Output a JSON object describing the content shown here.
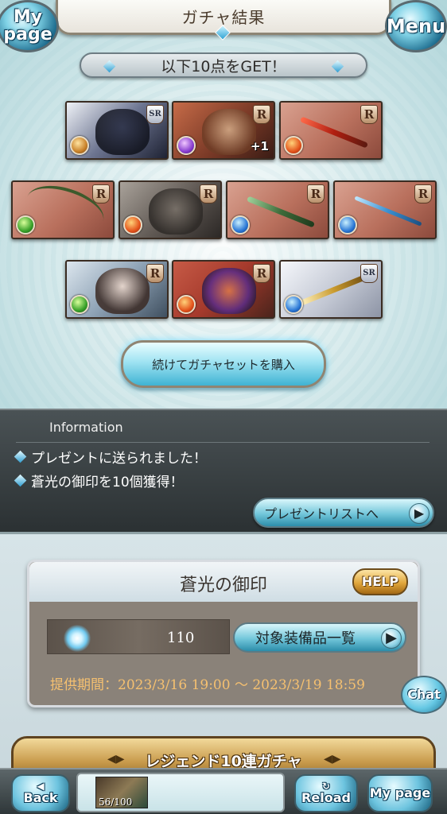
{
  "header": {
    "title": "ガチャ結果",
    "mypage_label": "My page",
    "menu_label": "Menu"
  },
  "banner": {
    "text": "以下10点をGET！"
  },
  "results": [
    {
      "rarity": "SR",
      "kind": "character",
      "element": "earth"
    },
    {
      "rarity": "R",
      "kind": "summon",
      "element": "dark",
      "badge": "+1"
    },
    {
      "rarity": "R",
      "kind": "weapon",
      "element": "fire"
    },
    {
      "rarity": "R",
      "kind": "weapon",
      "element": "wind"
    },
    {
      "rarity": "R",
      "kind": "summon",
      "element": "fire"
    },
    {
      "rarity": "R",
      "kind": "weapon",
      "element": "water"
    },
    {
      "rarity": "R",
      "kind": "weapon",
      "element": "water"
    },
    {
      "rarity": "R",
      "kind": "character",
      "element": "wind"
    },
    {
      "rarity": "R",
      "kind": "summon",
      "element": "fire"
    },
    {
      "rarity": "SR",
      "kind": "weapon",
      "element": "water"
    }
  ],
  "buy_again_label": "続けてガチャセットを購入",
  "information": {
    "title": "Information",
    "items": [
      "プレゼントに送られました！",
      "蒼光の御印を10個獲得！"
    ],
    "present_list_label": "プレゼントリストへ"
  },
  "seal": {
    "title": "蒼光の御印",
    "help_label": "HELP",
    "count": "110",
    "equipment_list_label": "対象装備品一覧",
    "period_label": "提供期間：2023/3/16 19:00 〜 2023/3/19 18:59"
  },
  "chat_label": "Chat",
  "legend_banner": "レジェンド10連ガチャ",
  "bottom_bar": {
    "back_label": "Back",
    "stamina": "56/100",
    "reload_label": "Reload",
    "mypage_label": "My page"
  },
  "colors": {
    "fire": "#e4541c",
    "wind": "#3aa22a",
    "water": "#2b78d6",
    "dark": "#8a3fd0",
    "earth": "#c9822a",
    "accent": "#72c6da"
  }
}
